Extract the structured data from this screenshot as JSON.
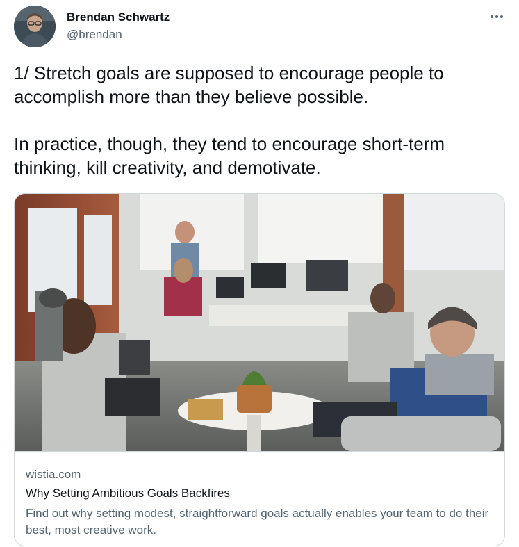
{
  "author": {
    "name": "Brendan Schwartz",
    "handle": "@brendan",
    "avatar_icon": "user-avatar"
  },
  "tweet": {
    "text": "1/ Stretch goals are supposed to encourage people to accomplish more than they believe possible.\n\nIn practice, though, they tend to encourage short-term thinking, kill creativity, and demotivate."
  },
  "card": {
    "domain": "wistia.com",
    "title": "Why Setting Ambitious Goals Backfires",
    "description": "Find out why setting modest, straightforward goals actually enables your team to do their best, most creative work.",
    "image_icon": "office-team-photo"
  },
  "colors": {
    "text_primary": "#0f1419",
    "text_secondary": "#536471",
    "border": "#cfd9de"
  }
}
